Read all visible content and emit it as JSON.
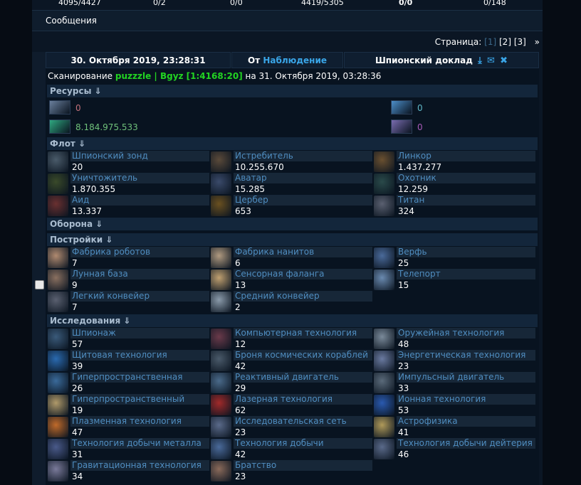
{
  "top_stats": [
    {
      "text": "4095/4427",
      "color": "#6b8fd8"
    },
    {
      "text": "0/2",
      "color": "#8a8a3a"
    },
    {
      "text": "0/0",
      "color": "#3e6e8c"
    },
    {
      "text": "4419/5305",
      "color": "#bbbbbb"
    },
    {
      "text": "0/0",
      "color": "#22c322"
    },
    {
      "text": "0/148",
      "color": "#bbbbbb"
    }
  ],
  "nav": {
    "messages_label": "Сообщения"
  },
  "pager": {
    "label": "Страница:",
    "current": "[1]",
    "pages": [
      "[2]",
      "[3]"
    ],
    "next": "»"
  },
  "report": {
    "date": "30. Октября 2019, 23:28:31",
    "from_label": "От",
    "from_link": "Наблюдение",
    "type": "Шпионский доклад",
    "scan_prefix": "Сканирование",
    "scan_target": "puzzzle | Bgyz [1:4168:20]",
    "scan_suffix": "на 31. Октября 2019, 03:28:36"
  },
  "sections": {
    "resources": "Ресурсы ⇓",
    "fleet": "Флот ⇓",
    "defense": "Оборона ⇓",
    "buildings": "Постройки ⇓",
    "research": "Исследования ⇓"
  },
  "resources": [
    {
      "value": "0",
      "color": "#c0707a",
      "icon_color": "#6a7f9c"
    },
    {
      "value": "0",
      "color": "#5fb8c8",
      "icon_color": "#4c8ec9"
    },
    {
      "value": "8.184.975.533",
      "color": "#6fc07a",
      "icon_color": "#2fa880"
    },
    {
      "value": "0",
      "color": "#a85ab8",
      "icon_color": "#7a6cb0"
    }
  ],
  "fleet": [
    {
      "name": "Шпионский зонд",
      "value": "20",
      "icon": "#4a5b6a"
    },
    {
      "name": "Истребитель",
      "value": "10.255.670",
      "icon": "#5a4a3a"
    },
    {
      "name": "Линкор",
      "value": "1.437.277",
      "icon": "#6a5030"
    },
    {
      "name": "Уничтожитель",
      "value": "1.870.355",
      "icon": "#3a4a2a"
    },
    {
      "name": "Аватар",
      "value": "15.285",
      "icon": "#3a4a6a"
    },
    {
      "name": "Охотник",
      "value": "12.259",
      "icon": "#2a4a4a"
    },
    {
      "name": "Аид",
      "value": "13.337",
      "icon": "#6a3030"
    },
    {
      "name": "Цербер",
      "value": "653",
      "icon": "#6a5020"
    },
    {
      "name": "Титан",
      "value": "324",
      "icon": "#5a6070"
    }
  ],
  "buildings": [
    {
      "name": "Фабрика роботов",
      "value": "7",
      "icon": "#b08a70"
    },
    {
      "name": "Фабрика нанитов",
      "value": "6",
      "icon": "#b09a80"
    },
    {
      "name": "Верфь",
      "value": "25",
      "icon": "#4a6a9a"
    },
    {
      "name": "Лунная база",
      "value": "9",
      "icon": "#8a7060"
    },
    {
      "name": "Сенсорная фаланга",
      "value": "13",
      "icon": "#c0a070"
    },
    {
      "name": "Телепорт",
      "value": "15",
      "icon": "#6a8ab0"
    },
    {
      "name": "Легкий конвейер",
      "value": "7",
      "icon": "#5a6070"
    },
    {
      "name": "Средний конвейер",
      "value": "2",
      "icon": "#8a9aaa"
    }
  ],
  "research": [
    {
      "name": "Шпионаж",
      "value": "57",
      "icon": "#3a5a7a"
    },
    {
      "name": "Компьютерная технология",
      "value": "12",
      "icon": "#6a3a4a"
    },
    {
      "name": "Оружейная технология",
      "value": "48",
      "icon": "#7a8a9a"
    },
    {
      "name": "Щитовая технология",
      "value": "39",
      "icon": "#2a6ab0"
    },
    {
      "name": "Броня космических кораблей",
      "value": "42",
      "icon": "#4a5a6a"
    },
    {
      "name": "Энергетическая технология",
      "value": "23",
      "icon": "#6a7aa0"
    },
    {
      "name": "Гиперпространственная",
      "value": "26",
      "icon": "#3a6a9a"
    },
    {
      "name": "Реактивный двигатель",
      "value": "29",
      "icon": "#4a6a8a"
    },
    {
      "name": "Импульсный двигатель",
      "value": "33",
      "icon": "#5a6a7a"
    },
    {
      "name": "Гиперпространственный",
      "value": "19",
      "icon": "#b09a6a"
    },
    {
      "name": "Лазерная технология",
      "value": "62",
      "icon": "#a02a2a"
    },
    {
      "name": "Ионная технология",
      "value": "53",
      "icon": "#2a5ab0"
    },
    {
      "name": "Плазменная технология",
      "value": "47",
      "icon": "#c06a2a"
    },
    {
      "name": "Исследовательская сеть",
      "value": "23",
      "icon": "#5a6a8a"
    },
    {
      "name": "Астрофизика",
      "value": "41",
      "icon": "#b09a5a"
    },
    {
      "name": "Технология добычи металла",
      "value": "31",
      "icon": "#4a5a8a"
    },
    {
      "name": "Технология добычи",
      "value": "42",
      "icon": "#4a6a9a"
    },
    {
      "name": "Технология добычи дейтерия",
      "value": "46",
      "icon": "#5a6a8a"
    },
    {
      "name": "Гравитационная технология",
      "value": "34",
      "icon": "#7a7a9a"
    },
    {
      "name": "Братство",
      "value": "23",
      "icon": "#8a6a5a"
    }
  ]
}
